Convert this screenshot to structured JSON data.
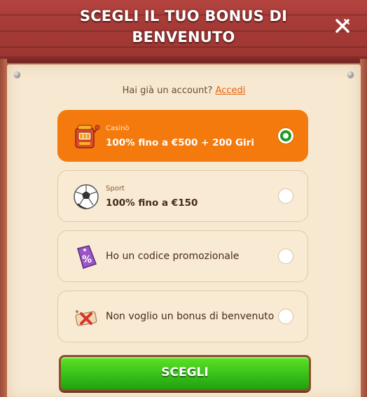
{
  "header": {
    "title": "SCEGLI IL TUO BONUS DI BENVENUTO",
    "close_icon": "close-x-icon"
  },
  "login": {
    "prompt": "Hai già un account?",
    "link": "Accedi"
  },
  "options": [
    {
      "icon": "slot-machine-icon",
      "category": "Casinò",
      "label": "100% fino a €500 + 200 Giri",
      "selected": true
    },
    {
      "icon": "soccer-ball-icon",
      "category": "Sport",
      "label": "100% fino a €150",
      "selected": false
    },
    {
      "icon": "percent-tag-icon",
      "category": "",
      "label": "Ho un codice promozionale",
      "selected": false
    },
    {
      "icon": "cancel-scroll-icon",
      "category": "",
      "label": "Non voglio un bonus di benvenuto",
      "selected": false
    }
  ],
  "submit": {
    "label": "SCEGLI"
  },
  "colors": {
    "selected_bg": "#f47a0d",
    "button_green": "#3bc41a",
    "header_red": "#a53a36",
    "parchment": "#f6e8d1"
  }
}
